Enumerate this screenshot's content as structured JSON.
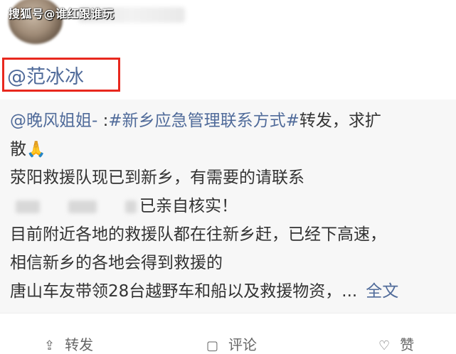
{
  "watermark": "搜狐号@谁红跟谁玩",
  "mention": "@范冰冰",
  "repost": {
    "author": "@晚风姐姐-",
    "separator": " :",
    "topic": "#新乡应急管理联系方式#",
    "line1_tail": "转发，求扩",
    "line2": "散",
    "line3": "荥阳救援队现已到新乡，有需要的请联系",
    "line4": "已亲自核实！",
    "line5": "目前附近各地的救援队都在往新乡赶，已经下高速，",
    "line6": "相信新乡的各地会得到救援的",
    "line7": "唐山车友带领28台越野车和船以及救援物资，...",
    "more_link": "全文"
  },
  "actions": [
    {
      "label": "转发",
      "icon": "share-icon"
    },
    {
      "label": "评论",
      "icon": "comment-icon"
    },
    {
      "label": "赞",
      "icon": "like-icon"
    }
  ]
}
